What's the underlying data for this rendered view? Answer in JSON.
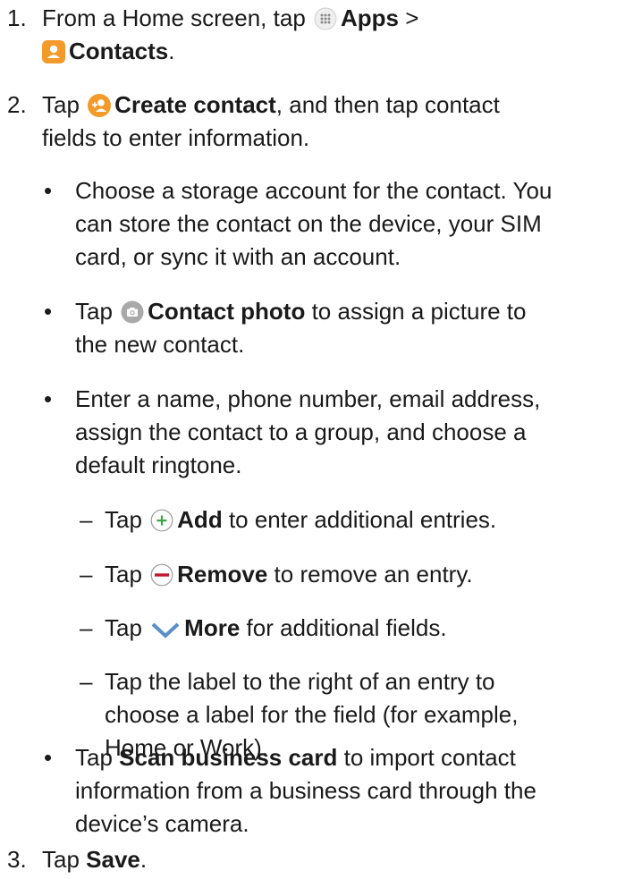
{
  "step1": {
    "num": "1.",
    "pre": "From a Home screen, tap",
    "apps_label": "Apps",
    "sep": ">",
    "contacts_label": "Contacts",
    "post": "."
  },
  "step2": {
    "num": "2.",
    "pre": "Tap",
    "create_label": "Create contact",
    "post_line1": ", and then tap contact",
    "line2": "fields to enter information."
  },
  "bullet_storage": {
    "line1": "Choose a storage account for the contact. You",
    "line2": "can store the contact on the device, your SIM",
    "line3": "card, or sync it with an account."
  },
  "bullet_photo": {
    "pre": "Tap",
    "label": "Contact photo",
    "post": "to assign a picture to",
    "line2": "the new contact."
  },
  "bullet_enter": {
    "line1": "Enter a name, phone number, email address,",
    "line2": "assign the contact to a group, and choose a",
    "line3": "default ringtone."
  },
  "sub_add": {
    "pre": "Tap",
    "label": "Add",
    "post": "to enter additional entries."
  },
  "sub_remove": {
    "pre": "Tap",
    "label": "Remove",
    "post": "to remove an entry."
  },
  "sub_more": {
    "pre": "Tap",
    "label": "More",
    "post": "for additional fields."
  },
  "sub_label": {
    "line1": "Tap the label to the right of an entry to",
    "line2": "choose a label for the field (for example,",
    "line3": "Home or Work)."
  },
  "bullet_scan": {
    "pre": "Tap",
    "label": "Scan business card",
    "post": "to import contact",
    "line2": "information from a business card through the",
    "line3": "device’s camera."
  },
  "step3": {
    "num": "3.",
    "pre": "Tap",
    "label": "Save",
    "post": "."
  },
  "symbols": {
    "bullet": "•",
    "dash": "–"
  },
  "icons": {
    "apps": "apps-grid-icon",
    "contacts": "contacts-app-icon",
    "create": "create-contact-icon",
    "photo": "camera-icon",
    "add": "add-plus-icon",
    "remove": "remove-minus-icon",
    "more": "chevron-down-icon"
  },
  "colors": {
    "orange": "#f39a2b",
    "green": "#3aa542",
    "red": "#c0182c",
    "gray": "#a9a9a9",
    "blue": "#5a8fc8"
  }
}
